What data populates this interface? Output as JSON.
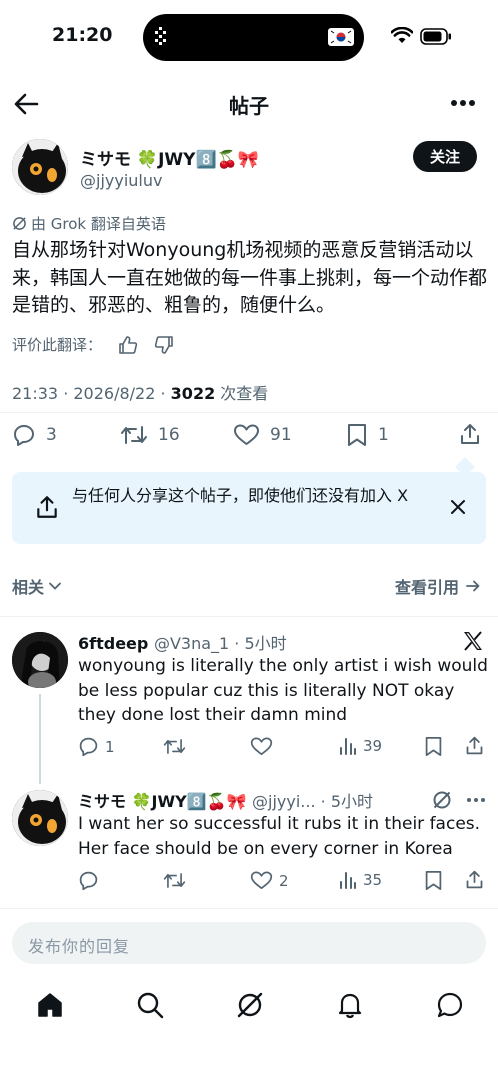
{
  "status_bar": {
    "time": "21:20"
  },
  "header": {
    "title": "帖子"
  },
  "post": {
    "author_name": "ミサモ 🍀JWY8️⃣🍒🎀",
    "author_handle": "@jjyyiuluv",
    "follow_label": "关注",
    "translated_by": "由 Grok 翻译自英语",
    "text": "自从那场针对Wonyoung机场视频的恶意反营销活动以来，韩国人一直在她做的每一件事上挑刺，每一个动作都是错的、邪恶的、粗鲁的，随便什么。",
    "rate_label": "评价此翻译：",
    "time": "21:33 · 2026/8/22 · ",
    "views": "3022",
    "views_label": " 次查看",
    "stats": {
      "replies": "3",
      "reposts": "16",
      "likes": "91",
      "bookmarks": "1"
    }
  },
  "share_banner": {
    "text": "与任何人分享这个帖子，即使他们还没有加入 X"
  },
  "related_label": "相关",
  "quotes_label": "查看引用",
  "replies": [
    {
      "name": "6ftdeep",
      "meta": "@V3na_1 · 5小时",
      "text": "wonyoung is literally the only artist i wish would be less popular cuz this is literally NOT okay they done lost their damn mind",
      "stats": {
        "replies": "1",
        "reposts": "",
        "likes": "",
        "views": "39"
      }
    },
    {
      "name": "ミサモ 🍀JWY8️⃣🍒🎀",
      "meta": "@jjyyi... · 5小时",
      "text": "I want her so successful it rubs it in their faces. Her face should be on every corner in Korea",
      "stats": {
        "replies": "",
        "reposts": "",
        "likes": "2",
        "views": "35"
      }
    }
  ],
  "reply_box": {
    "placeholder": "发布你的回复"
  },
  "colors": {
    "accent": "#1d9bf0",
    "banner_bg": "#e8f5fd",
    "text": "#0f1419",
    "muted": "#536471"
  },
  "icons": [
    "back-arrow-icon",
    "more-icon",
    "grok-icon",
    "thumb-up-icon",
    "thumb-down-icon",
    "reply-icon",
    "repost-icon",
    "like-icon",
    "bookmark-icon",
    "share-icon",
    "close-icon",
    "chevron-down-icon",
    "arrow-right-icon",
    "x-logo-icon",
    "views-icon",
    "home-icon",
    "search-icon",
    "grok-nav-icon",
    "notifications-icon",
    "messages-icon"
  ]
}
